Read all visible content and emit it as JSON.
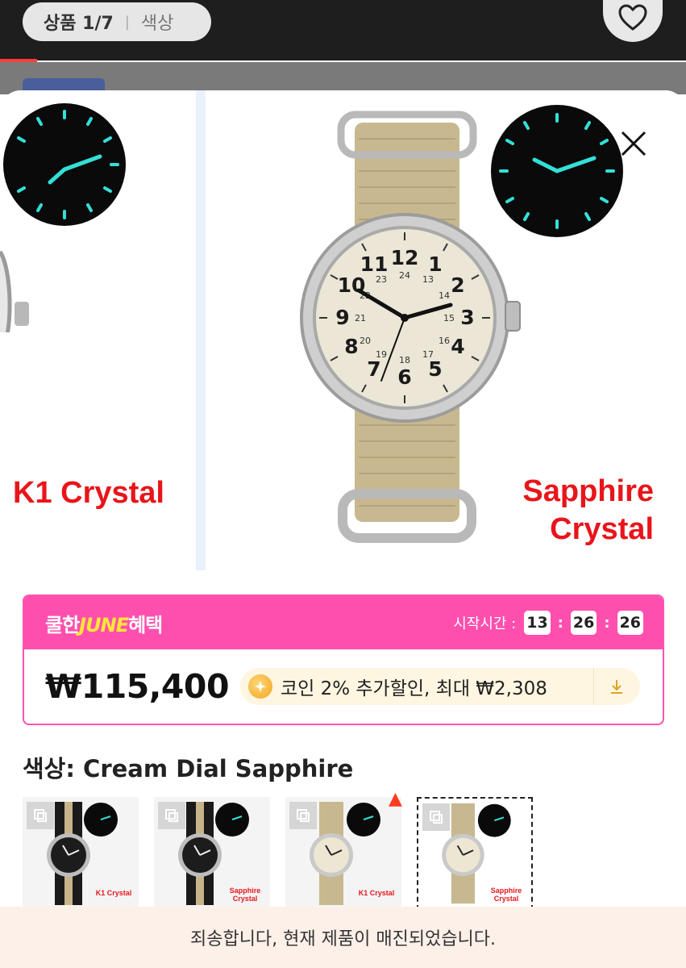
{
  "header": {
    "counter": "상품 1/7",
    "color_tab": "색상"
  },
  "gallery": {
    "left_label": "K1 Crystal",
    "main_label_line1": "Sapphire",
    "main_label_line2": "Crystal"
  },
  "promo": {
    "brand_prefix": "쿨한",
    "brand_june": "JUNE",
    "brand_suffix": "혜택",
    "timer_label": "시작시간 :",
    "hours": "13",
    "minutes": "26",
    "seconds": "26",
    "price": "₩115,400",
    "coin_text": "코인 2% 추가할인, 최대 ₩2,308"
  },
  "color": {
    "label": "색상: Cream Dial Sapphire",
    "options": [
      {
        "caption": "K1 Crystal",
        "dial": "black",
        "strap": "black-stripe"
      },
      {
        "caption_line1": "Sapphire",
        "caption_line2": "Crystal",
        "dial": "black",
        "strap": "black-stripe"
      },
      {
        "caption": "K1 Crystal",
        "dial": "cream",
        "strap": "khaki",
        "hot": true
      },
      {
        "caption_line1": "Sapphire",
        "caption_line2": "Crystal",
        "dial": "cream",
        "strap": "khaki",
        "selected": true
      }
    ]
  },
  "notice": "죄송합니다, 현재 제품이 매진되었습니다.",
  "colors": {
    "accent_pink": "#ff4fae",
    "label_red": "#e8151b",
    "june_yellow": "#ffe637"
  }
}
